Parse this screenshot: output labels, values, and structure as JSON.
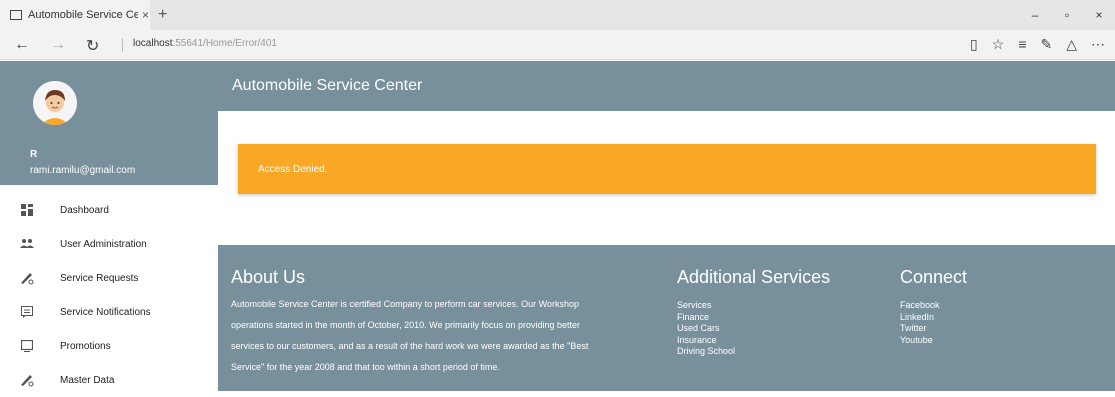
{
  "browser": {
    "tab_title": "Automobile Service Cen",
    "tab_close": "×",
    "new_tab": "+",
    "url_host": "localhost",
    "url_path": ":55641/Home/Error/401",
    "win_minimize": "–",
    "win_maximize": "▫",
    "win_close": "×",
    "back": "←",
    "forward": "→",
    "refresh": "↻",
    "tools": [
      "reading-view-icon",
      "favorite-star-icon",
      "hub-icon",
      "web-note-icon",
      "share-icon",
      "more-icon"
    ]
  },
  "user": {
    "initial": "R",
    "email": "rami.ramilu@gmail.com"
  },
  "menu": [
    {
      "label": "Dashboard",
      "icon": "dashboard-icon"
    },
    {
      "label": "User Administration",
      "icon": "users-icon"
    },
    {
      "label": "Service Requests",
      "icon": "service-requests-icon"
    },
    {
      "label": "Service Notifications",
      "icon": "notifications-icon"
    },
    {
      "label": "Promotions",
      "icon": "promotions-icon"
    },
    {
      "label": "Master Data",
      "icon": "master-data-icon"
    }
  ],
  "header": {
    "title": "Automobile Service Center"
  },
  "alert": {
    "message": "Access Denied."
  },
  "footer": {
    "about": {
      "heading": "About Us",
      "lines": [
        "Automobile Service Center is certified Company to perform car services. Our Workshop",
        "operations started in the month of October, 2010. We primarily focus on providing better",
        "services to our customers, and as a result of the hard work we were awarded as the \"Best",
        "Service\" for the year 2008 and that too within a short period of time."
      ]
    },
    "services": {
      "heading": "Additional Services",
      "items": [
        "Services",
        "Finance",
        "Used Cars",
        "Insurance",
        "Driving School"
      ]
    },
    "connect": {
      "heading": "Connect",
      "items": [
        "Facebook",
        "LinkedIn",
        "Twitter",
        "Youtube"
      ]
    }
  },
  "colors": {
    "primary": "#78909c",
    "alert": "#f9a825"
  }
}
